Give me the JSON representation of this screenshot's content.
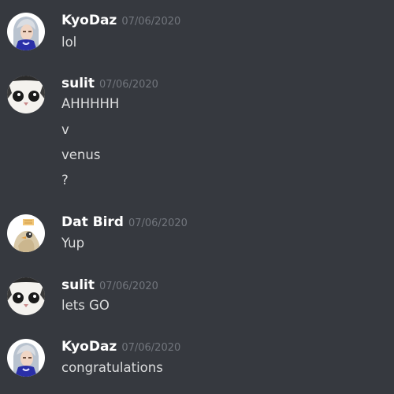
{
  "messages": [
    {
      "author": "KyoDaz",
      "timestamp": "07/06/2020",
      "avatar_icon": "anime-character-avatar-icon",
      "lines": [
        "lol"
      ]
    },
    {
      "author": "sulit",
      "timestamp": "07/06/2020",
      "avatar_icon": "cat-avatar-icon",
      "lines": [
        "AHHHHH",
        "v",
        "venus",
        "?"
      ]
    },
    {
      "author": "Dat Bird",
      "timestamp": "07/06/2020",
      "avatar_icon": "bird-avatar-icon",
      "lines": [
        "Yup"
      ]
    },
    {
      "author": "sulit",
      "timestamp": "07/06/2020",
      "avatar_icon": "cat-avatar-icon",
      "lines": [
        "lets GO"
      ]
    },
    {
      "author": "KyoDaz",
      "timestamp": "07/06/2020",
      "avatar_icon": "anime-character-avatar-icon",
      "lines": [
        "congratulations"
      ]
    }
  ],
  "colors": {
    "background": "#36393f",
    "author": "#ffffff",
    "timestamp": "#72767d",
    "message_text": "#dcddde"
  }
}
